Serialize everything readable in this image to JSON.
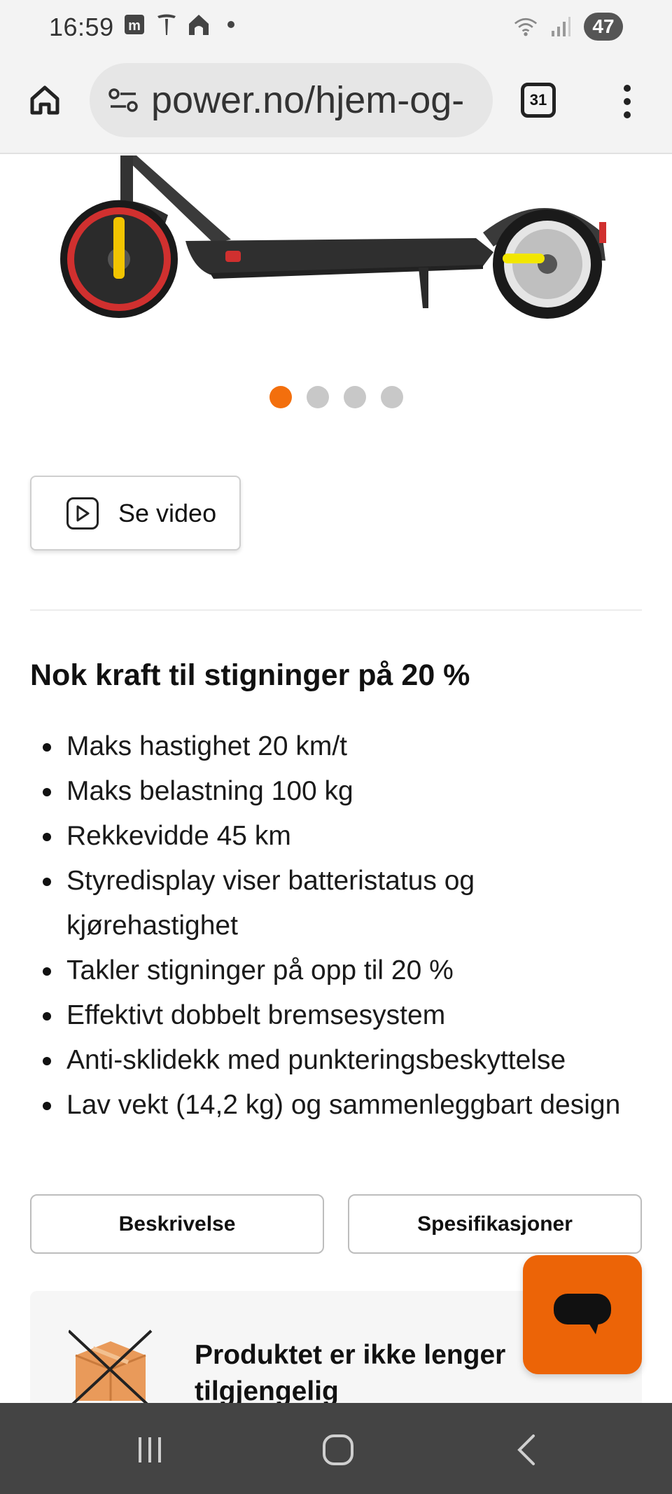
{
  "status_bar": {
    "time": "16:59",
    "battery": "47",
    "icons": [
      "m-app-icon",
      "tesla-icon",
      "home-app-icon",
      "dot-icon",
      "wifi-icon",
      "signal-icon"
    ]
  },
  "browser": {
    "url": "power.no/hjem-og-",
    "tab_count": "31"
  },
  "carousel": {
    "slide_count": 4,
    "active_index": 0
  },
  "video_button": {
    "label": "Se video"
  },
  "section": {
    "heading": "Nok kraft til stigninger på 20 %",
    "features": [
      "Maks hastighet 20 km/t",
      "Maks belastning 100 kg",
      "Rekkevidde 45 km",
      "Styredisplay viser batteristatus og kjørehastighet",
      "Takler stigninger på opp til 20 %",
      "Effektivt dobbelt bremsesystem",
      "Anti-sklidekk med punkteringsbeskyttelse",
      "Lav vekt (14,2 kg) og sammenleggbart design"
    ]
  },
  "tabs": {
    "description": "Beskrivelse",
    "specifications": "Spesifikasjoner"
  },
  "availability": {
    "message": "Produktet er ikke lenger tilgjengelig"
  },
  "colors": {
    "accent": "#f36f0d",
    "chat_button": "#ec6407",
    "nav_bar": "#444444"
  }
}
